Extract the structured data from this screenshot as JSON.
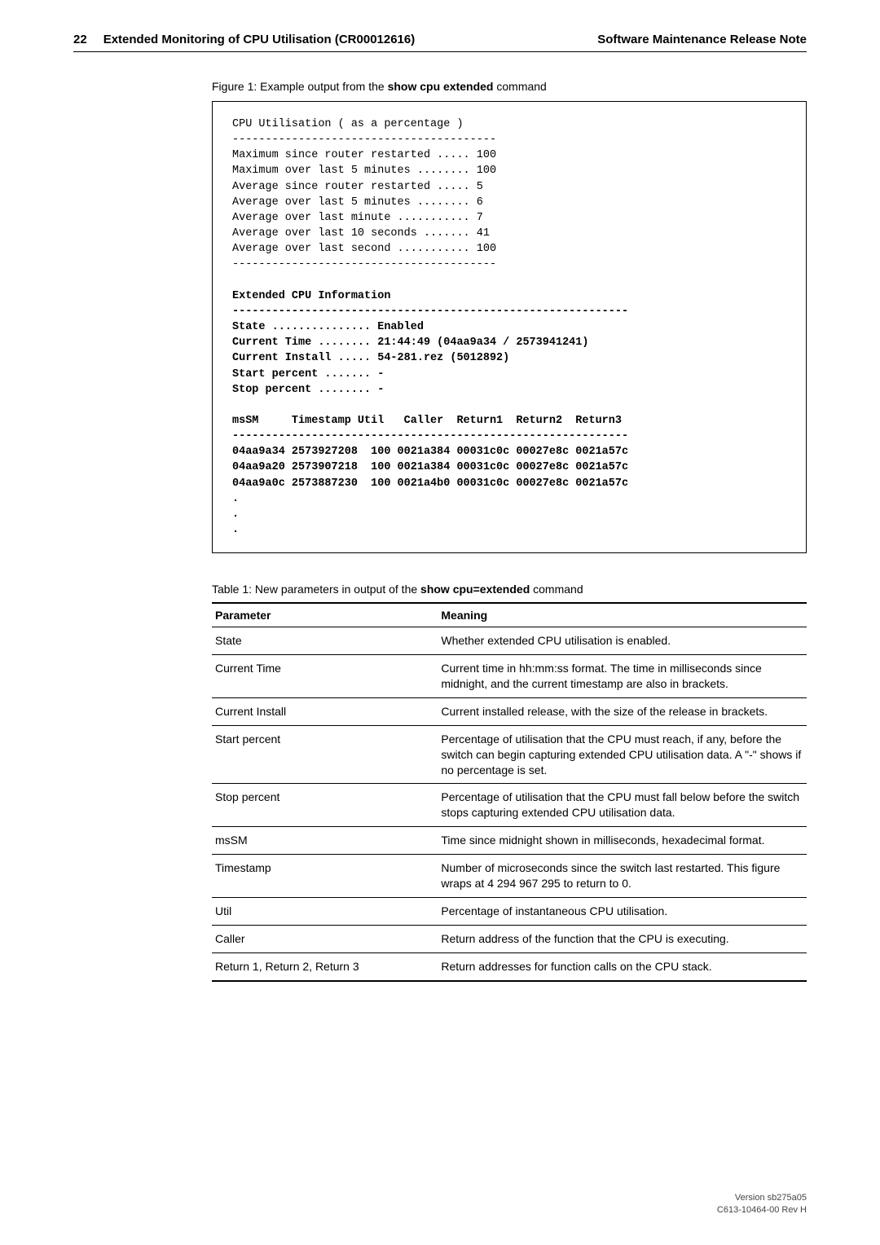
{
  "header": {
    "page_number": "22",
    "title_left": "Extended Monitoring of CPU Utilisation (CR00012616)",
    "title_right": "Software Maintenance Release Note"
  },
  "figure": {
    "caption_prefix": "Figure 1: Example output from the ",
    "caption_bold": "show cpu extended",
    "caption_suffix": " command",
    "plain_lines": [
      "CPU Utilisation ( as a percentage )",
      "----------------------------------------",
      "Maximum since router restarted ..... 100",
      "Maximum over last 5 minutes ........ 100",
      "Average since router restarted ..... 5",
      "Average over last 5 minutes ........ 6",
      "Average over last minute ........... 7",
      "Average over last 10 seconds ....... 41",
      "Average over last second ........... 100",
      "----------------------------------------",
      ""
    ],
    "bold_lines": [
      "Extended CPU Information",
      "------------------------------------------------------------",
      "State ............... Enabled",
      "Current Time ........ 21:44:49 (04aa9a34 / 2573941241)",
      "Current Install ..... 54-281.rez (5012892)",
      "Start percent ....... -",
      "Stop percent ........ -",
      "",
      "msSM     Timestamp Util   Caller  Return1  Return2  Return3",
      "------------------------------------------------------------",
      "04aa9a34 2573927208  100 0021a384 00031c0c 00027e8c 0021a57c",
      "04aa9a20 2573907218  100 0021a384 00031c0c 00027e8c 0021a57c",
      "04aa9a0c 2573887230  100 0021a4b0 00031c0c 00027e8c 0021a57c",
      ".",
      ".",
      "."
    ]
  },
  "table": {
    "caption_prefix": "Table 1: New parameters in output of the ",
    "caption_bold": "show cpu=extended",
    "caption_suffix": " command",
    "head_param": "Parameter",
    "head_meaning": "Meaning",
    "rows": [
      {
        "param": "State",
        "meaning": "Whether extended CPU utilisation is enabled."
      },
      {
        "param": "Current Time",
        "meaning": "Current time in hh:mm:ss format. The time in milliseconds since midnight, and the current timestamp are also in brackets."
      },
      {
        "param": "Current Install",
        "meaning": "Current installed release, with the size of the release in brackets."
      },
      {
        "param": "Start percent",
        "meaning": "Percentage of utilisation that the CPU must reach, if any, before the switch can begin capturing extended CPU utilisation data. A \"-\" shows if no percentage is set."
      },
      {
        "param": "Stop percent",
        "meaning": "Percentage of utilisation that the CPU must fall below before the switch stops capturing extended CPU utilisation data."
      },
      {
        "param": "msSM",
        "meaning": "Time since midnight shown in milliseconds, hexadecimal format."
      },
      {
        "param": "Timestamp",
        "meaning": "Number of microseconds since the switch last restarted. This figure wraps at 4 294 967 295 to return to 0."
      },
      {
        "param": "Util",
        "meaning": "Percentage of instantaneous CPU utilisation."
      },
      {
        "param": "Caller",
        "meaning": "Return address of the function that the CPU is executing."
      },
      {
        "param": "Return 1, Return 2, Return 3",
        "meaning": "Return addresses for function calls on the CPU stack."
      }
    ]
  },
  "footer": {
    "line1": "Version sb275a05",
    "line2": "C613-10464-00 Rev H"
  }
}
